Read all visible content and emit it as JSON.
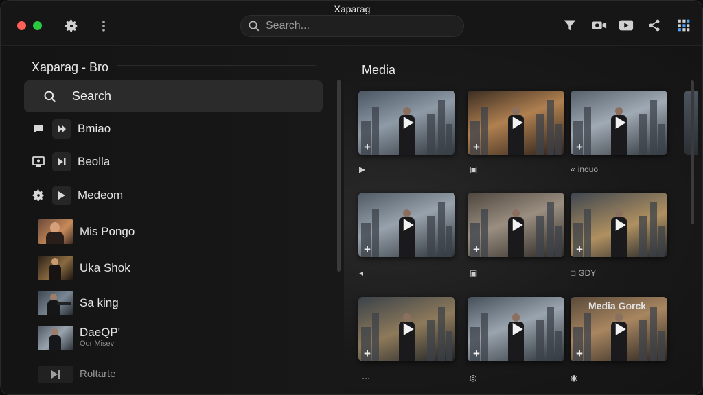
{
  "window": {
    "title": "Xaparag"
  },
  "search": {
    "placeholder": "Search..."
  },
  "sidebar": {
    "title": "Xaparag - Bro",
    "search_label": "Search",
    "nav": [
      {
        "label": "Bmiao",
        "icon1": "flag-icon",
        "icon2": "forward-icon"
      },
      {
        "label": "Beolla",
        "icon1": "monitor-icon",
        "icon2": "skip-icon"
      },
      {
        "label": "Medeom",
        "icon1": "gear-icon",
        "icon2": "play-icon"
      }
    ],
    "people": [
      {
        "label": "Mis Pongo",
        "sub": ""
      },
      {
        "label": "Uka Shok",
        "sub": ""
      },
      {
        "label": "Sa king",
        "sub": ""
      },
      {
        "label": "DaeQP'",
        "sub": "Oor Misev"
      },
      {
        "label": "Roltarte",
        "sub": ""
      }
    ]
  },
  "main": {
    "title": "Media",
    "cards": [
      {
        "caption": "",
        "overlay": ""
      },
      {
        "caption": "",
        "overlay": ""
      },
      {
        "caption": "inouo",
        "overlay": ""
      },
      {
        "caption": "",
        "overlay": ""
      },
      {
        "caption": "",
        "overlay": ""
      },
      {
        "caption": "GDY",
        "overlay": ""
      },
      {
        "caption": "···",
        "overlay": ""
      },
      {
        "caption": "",
        "overlay": ""
      },
      {
        "caption": "",
        "overlay": "Media Gorck"
      }
    ]
  },
  "colors": {
    "close": "#ff5f57",
    "zoom": "#28c840",
    "accent": "#f2f2f2"
  }
}
